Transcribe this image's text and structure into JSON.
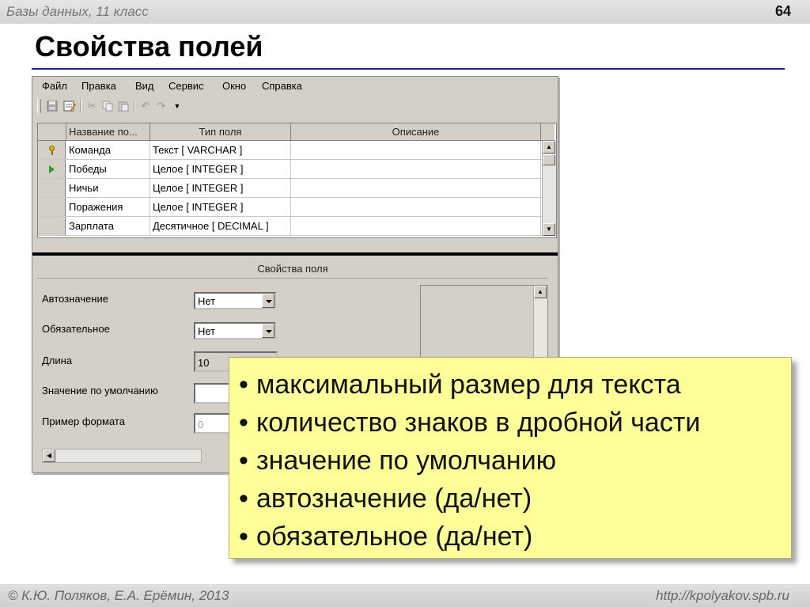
{
  "slide": {
    "course": "Базы данных, 11 класс",
    "number": "64",
    "title": "Свойства полей",
    "footer_left": "© К.Ю. Поляков, Е.А. Ерёмин, 2013",
    "footer_right": "http://kpolyakov.spb.ru"
  },
  "window": {
    "menu": [
      "Файл",
      "Правка",
      "Вид",
      "Сервис",
      "Окно",
      "Справка"
    ],
    "toolbar_icons": [
      "save-icon",
      "edit-design-icon",
      "cut-icon",
      "copy-icon",
      "paste-icon",
      "undo-icon",
      "redo-icon",
      "toolbar-dropdown-icon"
    ],
    "grid": {
      "headers": [
        "Название по...",
        "Тип поля",
        "Описание"
      ],
      "rows": [
        {
          "name": "Команда",
          "type": "Текст [ VARCHAR ]",
          "marker": "key-icon"
        },
        {
          "name": "Победы",
          "type": "Целое [ INTEGER ]",
          "marker": "current-row-arrow-icon"
        },
        {
          "name": "Ничьи",
          "type": "Целое [ INTEGER ]",
          "marker": ""
        },
        {
          "name": "Поражения",
          "type": "Целое [ INTEGER ]",
          "marker": ""
        },
        {
          "name": "Зарплата",
          "type": "Десятичное [ DECIMAL ]",
          "marker": ""
        }
      ]
    },
    "properties": {
      "header": "Свойства поля",
      "autovalue_label": "Автозначение",
      "autovalue_value": "Нет",
      "required_label": "Обязательное",
      "required_value": "Нет",
      "length_label": "Длина",
      "length_value": "10",
      "default_label": "Значение по умолчанию",
      "default_value": "",
      "format_label": "Пример формата",
      "format_value": "0"
    }
  },
  "callout": {
    "bullet": "•",
    "items": [
      "максимальный размер для текста",
      "количество знаков в дробной части",
      "значение по умолчанию",
      "автозначение (да/нет)",
      "обязательное (да/нет)"
    ]
  },
  "colors": {
    "title_rule": "#1a237e",
    "callout_bg": "#ffff99",
    "window_bg": "#d4d0c8"
  }
}
